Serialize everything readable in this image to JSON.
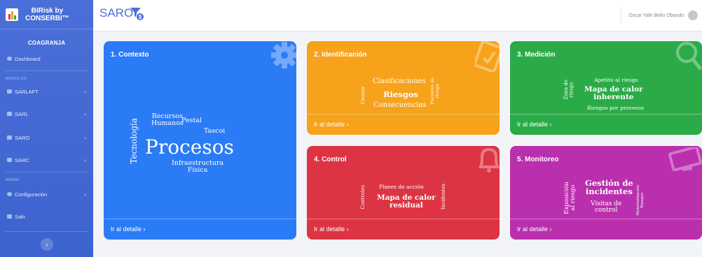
{
  "brand": {
    "line1": "BIRisk by",
    "line2": "CONSERBI™"
  },
  "sidebar": {
    "org": "COAGRANJA",
    "dashboard": "Dashboard",
    "modules_label": "MÓDULOS",
    "modules": [
      "SARLAFT",
      "SARL",
      "SARO",
      "SARC"
    ],
    "admin_label": "ADMIN",
    "config": "Configuración",
    "logout": "Salir",
    "collapse": "‹"
  },
  "header": {
    "title": "SARO",
    "badge": "$",
    "user": "Oscar Yafir Bello Obando"
  },
  "footer_link": "Ir al detalle ›",
  "colors": {
    "contexto": "#2b7bf7",
    "identificacion": "#f7a21b",
    "medicion": "#2bab48",
    "control": "#dd3444",
    "monitoreo": "#ba2fae",
    "sidebar": "#4a6fd8"
  },
  "cards": {
    "contexto": {
      "title": "1. Contexto",
      "icon": "gear-icon",
      "words": {
        "recursos": "Recursos\nHumanos",
        "pestal": "Pestal",
        "tascoi": "Tascoi",
        "tecnologia": "Tecnología",
        "procesos": "Procesos",
        "infra": "Infraestructura\nFísica"
      }
    },
    "identificacion": {
      "title": "2. Identificación",
      "icon": "checklist-icon",
      "words": {
        "causas": "Causas",
        "clasif": "Clasificaciones",
        "riesgos": "Riesgos",
        "consec": "Consecuencias",
        "factores": "Factores de\nriesgo"
      }
    },
    "medicion": {
      "title": "3. Medición",
      "icon": "magnifier-icon",
      "words": {
        "zona": "Zona de\nriesgo",
        "apetito": "Apetito al riesgo",
        "mapa": "Mapa de calor\ninherente",
        "porproc": "Riesgos por procesos"
      }
    },
    "control": {
      "title": "4. Control",
      "icon": "bell-icon",
      "words": {
        "controles": "Controles",
        "planes": "Planes de acción",
        "mapa": "Mapa de calor\nresidual",
        "incidentes": "Incidentes"
      }
    },
    "monitoreo": {
      "title": "5. Monitoreo",
      "icon": "monitor-icon",
      "words": {
        "exposicion": "Exposición\nal riesgo",
        "gestion": "Gestión de\nincidentes",
        "visitas": "Visitas de\ncontrol",
        "material": "Materialización\nRiesgos"
      }
    }
  }
}
